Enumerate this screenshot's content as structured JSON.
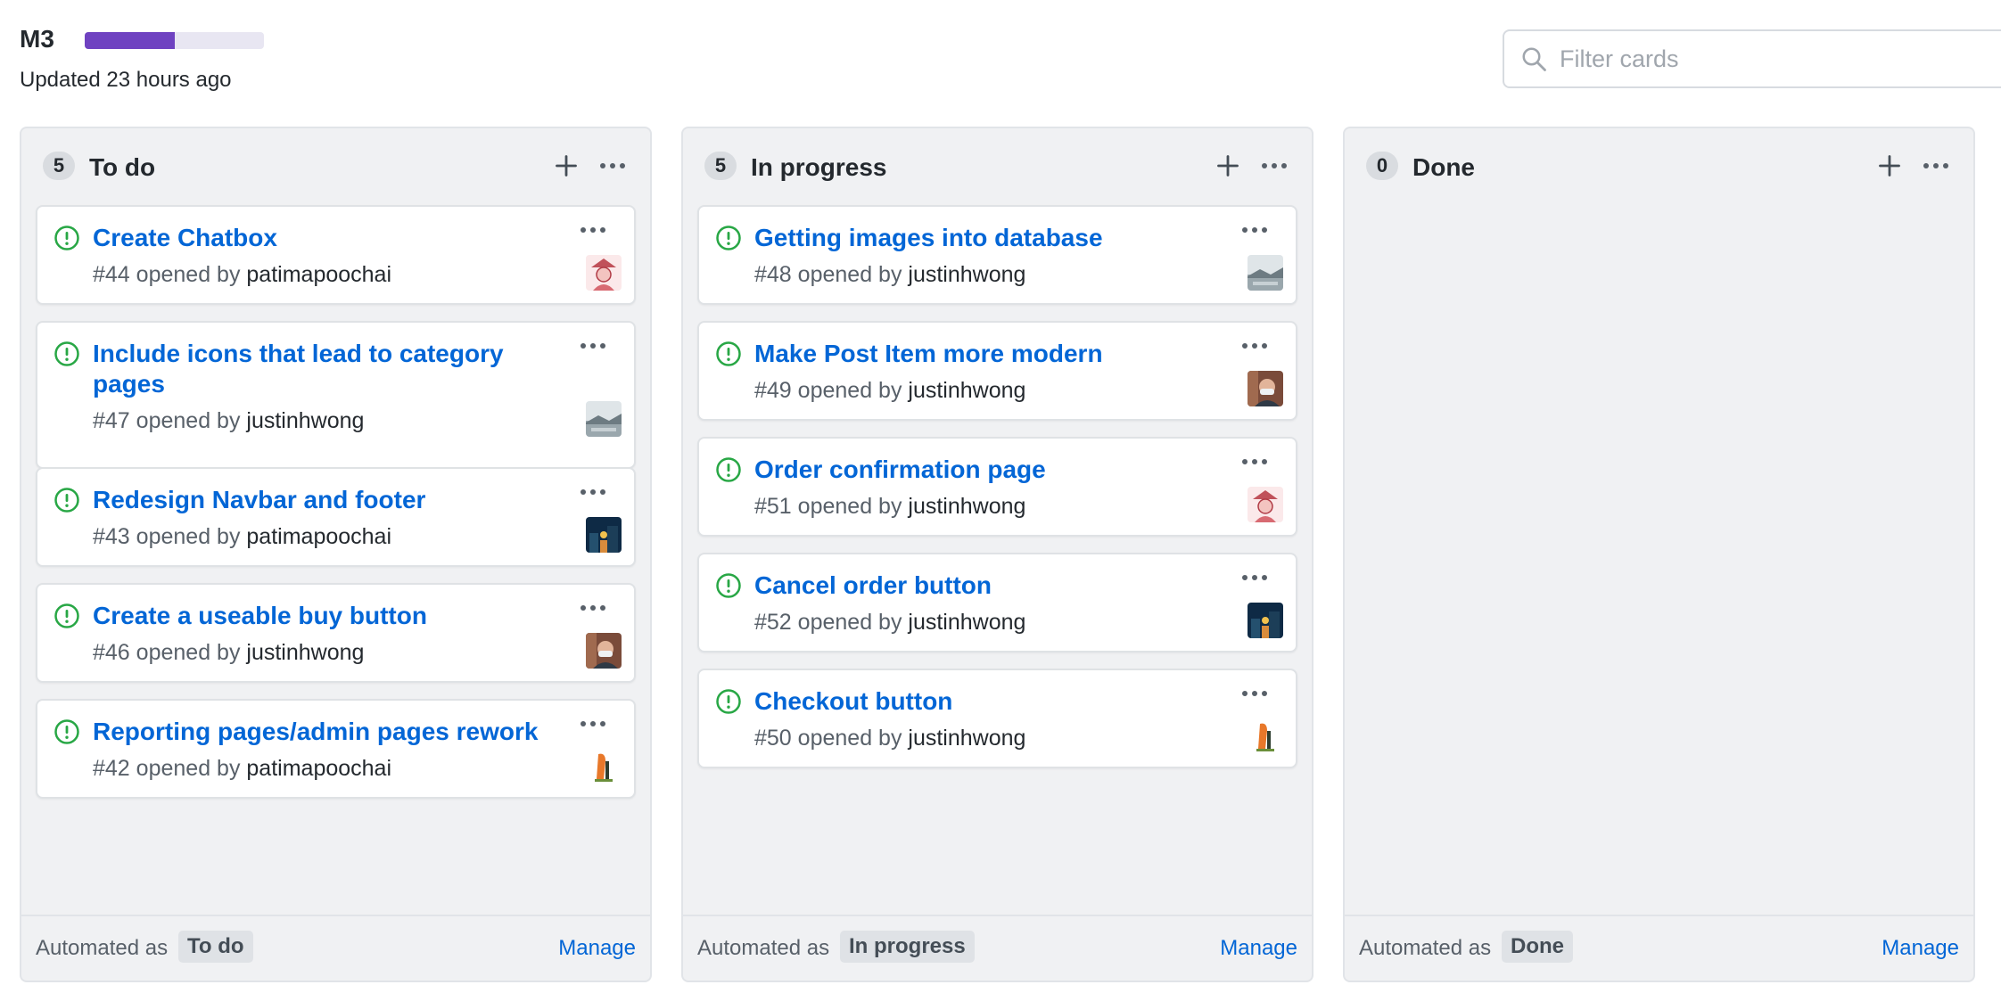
{
  "header": {
    "board_name": "M3",
    "progress_fraction": 0.5,
    "progress_color": "#6f42c1",
    "updated": "Updated 23 hours ago"
  },
  "filter": {
    "placeholder": "Filter cards"
  },
  "colors": {
    "link": "#0366d6",
    "issue_open": "#28a745"
  },
  "columns": [
    {
      "count": "5",
      "title": "To do",
      "automated_label": "Automated as",
      "automated_value": "To do",
      "manage": "Manage",
      "cards": [
        {
          "title": "Create Chatbox",
          "number": "#44",
          "opened_by": "opened by",
          "author": "patimapoochai",
          "avatar": "avatar-red-illustration"
        },
        {
          "title": "Include icons that lead to category pages",
          "number": "#47",
          "opened_by": "opened by",
          "author": "justinhwong",
          "avatar": "avatar-gray-landscape"
        },
        {
          "title": "Redesign Navbar and footer",
          "number": "#43",
          "opened_by": "opened by",
          "author": "patimapoochai",
          "avatar": "avatar-night-scene"
        },
        {
          "title": "Create a useable buy button",
          "number": "#46",
          "opened_by": "opened by",
          "author": "justinhwong",
          "avatar": "avatar-person-mask"
        },
        {
          "title": "Reporting pages/admin pages rework",
          "number": "#42",
          "opened_by": "opened by",
          "author": "patimapoochai",
          "avatar": "avatar-orange-figure"
        }
      ]
    },
    {
      "count": "5",
      "title": "In progress",
      "automated_label": "Automated as",
      "automated_value": "In progress",
      "manage": "Manage",
      "cards": [
        {
          "title": "Getting images into database",
          "number": "#48",
          "opened_by": "opened by",
          "author": "justinhwong",
          "avatar": "avatar-gray-landscape"
        },
        {
          "title": "Make Post Item more modern",
          "number": "#49",
          "opened_by": "opened by",
          "author": "justinhwong",
          "avatar": "avatar-person-mask"
        },
        {
          "title": "Order confirmation page",
          "number": "#51",
          "opened_by": "opened by",
          "author": "justinhwong",
          "avatar": "avatar-red-illustration"
        },
        {
          "title": "Cancel order button",
          "number": "#52",
          "opened_by": "opened by",
          "author": "justinhwong",
          "avatar": "avatar-night-scene"
        },
        {
          "title": "Checkout button",
          "number": "#50",
          "opened_by": "opened by",
          "author": "justinhwong",
          "avatar": "avatar-orange-figure"
        }
      ]
    },
    {
      "count": "0",
      "title": "Done",
      "automated_label": "Automated as",
      "automated_value": "Done",
      "manage": "Manage",
      "cards": []
    }
  ]
}
